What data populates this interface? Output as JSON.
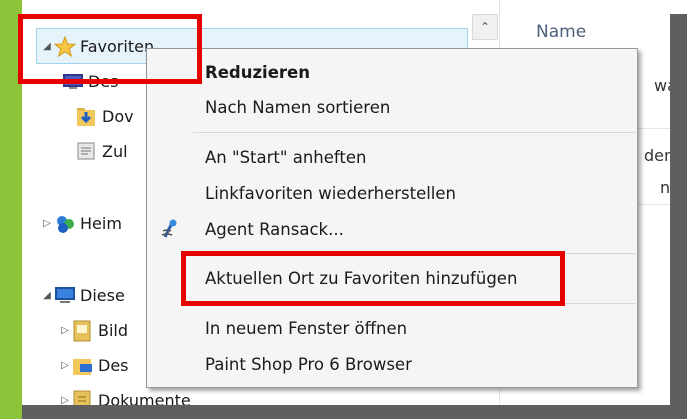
{
  "tree": {
    "items": [
      {
        "label": "Favoriten",
        "arrow": "◢",
        "icon": "star-icon"
      },
      {
        "label": "Des",
        "arrow": "",
        "icon": "desktop-icon"
      },
      {
        "label": "Dov",
        "arrow": "",
        "icon": "downloads-icon"
      },
      {
        "label": "Zul",
        "arrow": "",
        "icon": "recent-places-icon"
      },
      {
        "label": "Heim",
        "arrow": "▷",
        "icon": "homegroup-icon"
      },
      {
        "label": "Diese",
        "arrow": "◢",
        "icon": "this-pc-icon"
      },
      {
        "label": "Bild",
        "arrow": "▷",
        "icon": "pictures-library-icon"
      },
      {
        "label": "Des",
        "arrow": "▷",
        "icon": "desktop-folder-icon"
      },
      {
        "label": "Dokumente",
        "arrow": "▷",
        "icon": "documents-library-icon"
      }
    ]
  },
  "scrollbar": {
    "up_glyph": "⌃"
  },
  "right_pane": {
    "column_header": "Name",
    "partial_1": "wa",
    "partial_2": "den",
    "partial_3": "n"
  },
  "context_menu": {
    "items": [
      {
        "label": "Reduzieren",
        "bold": true
      },
      {
        "label": "Nach Namen sortieren"
      },
      {
        "label": "An \"Start\" anheften"
      },
      {
        "label": "Linkfavoriten wiederherstellen"
      },
      {
        "label": "Agent Ransack...",
        "icon": "agent-ransack-icon"
      },
      {
        "label": "Aktuellen Ort zu Favoriten hinzufügen"
      },
      {
        "label": "In neuem Fenster öffnen"
      },
      {
        "label": "Paint Shop Pro 6 Browser"
      }
    ]
  },
  "colors": {
    "highlight": "#e60000",
    "accent_strip": "#8cc43c",
    "selection": "#e6f3fb"
  }
}
